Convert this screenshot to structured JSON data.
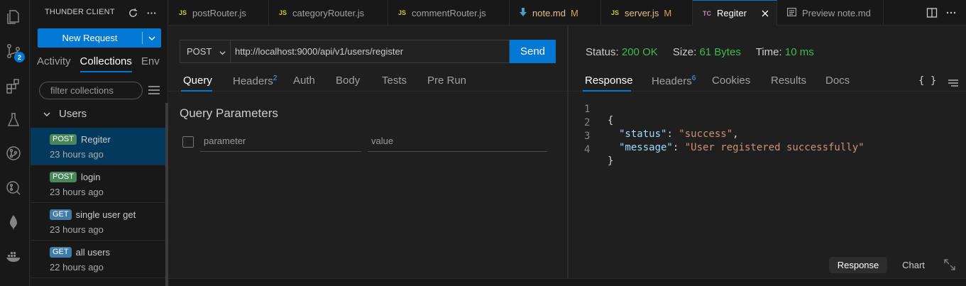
{
  "activity_bar": {
    "icons": [
      "explorer-icon",
      "source-control-icon",
      "extensions-icon",
      "testing-icon",
      "git-graph-icon",
      "search-git-icon",
      "mongodb-leaf-icon",
      "docker-icon"
    ],
    "source_control_badge": "2"
  },
  "sidebar": {
    "title": "THUNDER CLIENT",
    "new_request_label": "New Request",
    "tabs": [
      "Activity",
      "Collections",
      "Env"
    ],
    "active_tab": "Collections",
    "filter_placeholder": "filter collections",
    "group_name": "Users",
    "requests": [
      {
        "method": "POST",
        "name": "Regiter",
        "time": "23 hours ago",
        "active": true
      },
      {
        "method": "POST",
        "name": "login",
        "time": "23 hours ago",
        "active": false
      },
      {
        "method": "GET",
        "name": "single user get",
        "time": "23 hours ago",
        "active": false
      },
      {
        "method": "GET",
        "name": "all users",
        "time": "22 hours ago",
        "active": false
      }
    ]
  },
  "tabs": [
    {
      "icon": "JS",
      "label": "postRouter.js",
      "modified": ""
    },
    {
      "icon": "JS",
      "label": "categoryRouter.js",
      "modified": ""
    },
    {
      "icon": "JS",
      "label": "commentRouter.js",
      "modified": ""
    },
    {
      "icon": "markdown-icon",
      "label": "note.md",
      "modified": "M"
    },
    {
      "icon": "JS",
      "label": "server.js",
      "modified": "M"
    },
    {
      "icon": "TC",
      "label": "Regiter",
      "modified": "",
      "active": true
    },
    {
      "icon": "preview-icon",
      "label": "Preview note.md",
      "modified": ""
    }
  ],
  "request": {
    "method": "POST",
    "url": "http://localhost:9000/api/v1/users/register",
    "send_label": "Send",
    "tabs": [
      "Query",
      "Headers",
      "Auth",
      "Body",
      "Tests",
      "Pre Run"
    ],
    "headers_count": "2",
    "active_tab": "Query",
    "query_title": "Query Parameters",
    "param_placeholder": "parameter",
    "value_placeholder": "value"
  },
  "response": {
    "status_label": "Status:",
    "status_value": "200 OK",
    "size_label": "Size:",
    "size_value": "61 Bytes",
    "time_label": "Time:",
    "time_value": "10 ms",
    "tabs": [
      "Response",
      "Headers",
      "Cookies",
      "Results",
      "Docs"
    ],
    "headers_count": "6",
    "active_tab": "Response",
    "json_icon_label": "{ }",
    "lines": [
      {
        "n": "1",
        "text": "{"
      },
      {
        "n": "2",
        "key": "\"status\"",
        "value": "\"success\"",
        "trail": ","
      },
      {
        "n": "3",
        "key": "\"message\"",
        "value": "\"User registered successfully\"",
        "trail": ""
      },
      {
        "n": "4",
        "text": "}"
      }
    ],
    "view_buttons": [
      "Response",
      "Chart"
    ],
    "active_view": "Response"
  }
}
